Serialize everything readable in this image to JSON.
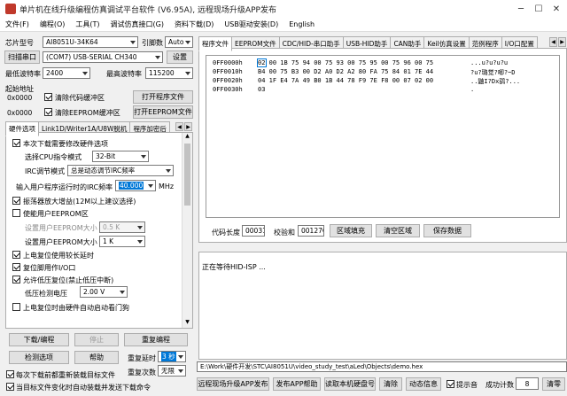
{
  "window": {
    "title": "单片机在线升级编程仿真调试平台软件 (V6.95A), 远程现场升级APP发布",
    "min": "─",
    "max": "☐",
    "close": "✕"
  },
  "menu": [
    "文件(F)",
    "编程(O)",
    "工具(T)",
    "调试仿真接口(G)",
    "资料下载(D)",
    "USB驱动安装(D)",
    "English"
  ],
  "left": {
    "chip_label": "芯片型号",
    "chip_value": "AI8051U-34K64",
    "pin_label": "引脚数",
    "pin_value": "Auto",
    "scan_button": "扫描串口",
    "port_value": "(COM7) USB-SERIAL CH340",
    "settings_button": "设置",
    "min_baud_label": "最低波特率",
    "min_baud_value": "2400",
    "max_baud_label": "最高波特率",
    "max_baud_value": "115200",
    "start_addr_label": "起始地址",
    "addr1": "0x0000",
    "addr2": "0x0000",
    "clear_code_label": "清除代码缓冲区",
    "clear_eeprom_label": "清除EEPROM缓冲区",
    "open_program_button": "打开程序文件",
    "open_eeprom_button": "打开EEPROM文件",
    "tabs": [
      "硬件选项",
      "Link1D/Writer1A/U8W脱机",
      "程序加密后"
    ],
    "options": {
      "modify_hw": "本次下载需要修改硬件选项",
      "cpu_mode_label": "选择CPU指令模式",
      "cpu_mode_value": "32-Bit",
      "irc_mode_label": "IRC调节模式",
      "irc_mode_value": "总是动态调节IRC频率",
      "irc_freq_label": "输入用户程序运行时的IRC频率",
      "irc_freq_value": "40.000",
      "irc_freq_unit": "MHz",
      "osc_gain": "振荡器放大增益(12M以上建议选择)",
      "user_eeprom": "使能用户EEPROM区",
      "eeprom_size_label": "设置用户EEPROM大小",
      "eeprom_size_value": "0.5 K",
      "eeprom_size2_label": "设置用户EEPROM大小",
      "eeprom_size2_value": "1 K",
      "power_on_delay": "上电复位使用较长延时",
      "reset_pin": "复位脚用作I/O口",
      "lvd_reset": "允许低压复位(禁止低压中断)",
      "lvd_voltage_label": "低压检测电压",
      "lvd_voltage_value": "2.00 V",
      "watchdog": "上电复位时由硬件自动启动看门狗"
    },
    "download_button": "下载/编程",
    "stop_button": "停止",
    "reprogram_button": "重复编程",
    "detect_button": "检测选项",
    "help_button": "帮助",
    "repeat_delay_label": "重复延时",
    "repeat_delay_value": "3 秒",
    "repeat_count_label": "重复次数",
    "repeat_count_value": "无限",
    "reload_label": "每次下载前都重新装载目标文件",
    "auto_load_label": "当目标文件变化时自动装载并发送下载命令"
  },
  "right": {
    "tabs": [
      "程序文件",
      "EEPROM文件",
      "CDC/HID-串口助手",
      "USB-HID助手",
      "CAN助手",
      "Keil仿真设置",
      "范例程序",
      "I/O口配置"
    ],
    "hex_rows": [
      {
        "addr": "0FF0000h",
        "bytes": "02 00 1B 75 94 00 75 93 00 75 95 00 75 96 00 75",
        "ascii": "...u?u?u?u"
      },
      {
        "addr": "0FF0010h",
        "bytes": "B4 00 75 B3 00 D2 A0 D2 A2 80 FA 75 84 01 7E 44",
        "ascii": "?u?璐觉?唧?~D"
      },
      {
        "addr": "0FF0020h",
        "bytes": "04 1F E4 7A 49 B0 1B 44 78 F9 7E F8 00 07 02 00",
        "ascii": "..鼬I?Dx鹞?..."
      },
      {
        "addr": "0FF0030h",
        "bytes": "03",
        "ascii": "."
      }
    ],
    "code_len_label": "代码长度",
    "code_len_value": "00031",
    "checksum_label": "校验和",
    "checksum_value": "00127C",
    "fill_button": "区域填充",
    "clear_button": "清空区域",
    "save_button": "保存数据",
    "log_text": "正在等待HID-ISP ...",
    "path": "E:\\Work\\硬件开发\\STC\\AI8051U\\video_study_test\\aLed\\Objects\\demo.hex",
    "remote_button": "远程现场升级APP发布",
    "publish_button": "发布APP帮助",
    "read_id_button": "读取本机硬盘号",
    "clear_btn2": "清除",
    "dynamic_button": "动态信息",
    "prompt_label": "提示音",
    "success_label": "成功计数",
    "success_value": "8",
    "clear_btn3": "清零"
  },
  "colors": {
    "accent": "#0078d7",
    "selection": "#0078d7"
  }
}
